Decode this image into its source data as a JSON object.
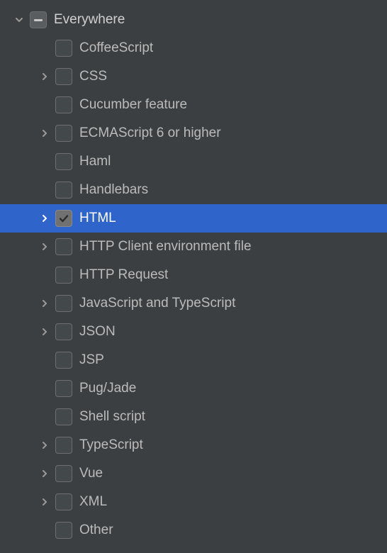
{
  "tree": {
    "root": {
      "label": "Everywhere",
      "expanded": true,
      "checkState": "indeterminate",
      "children": [
        {
          "label": "CoffeeScript",
          "expandable": false,
          "checkState": "unchecked"
        },
        {
          "label": "CSS",
          "expandable": true,
          "checkState": "unchecked"
        },
        {
          "label": "Cucumber feature",
          "expandable": false,
          "checkState": "unchecked"
        },
        {
          "label": "ECMAScript 6 or higher",
          "expandable": true,
          "checkState": "unchecked"
        },
        {
          "label": "Haml",
          "expandable": false,
          "checkState": "unchecked"
        },
        {
          "label": "Handlebars",
          "expandable": false,
          "checkState": "unchecked"
        },
        {
          "label": "HTML",
          "expandable": true,
          "checkState": "checked",
          "selected": true
        },
        {
          "label": "HTTP Client environment file",
          "expandable": true,
          "checkState": "unchecked"
        },
        {
          "label": "HTTP Request",
          "expandable": false,
          "checkState": "unchecked"
        },
        {
          "label": "JavaScript and TypeScript",
          "expandable": true,
          "checkState": "unchecked"
        },
        {
          "label": "JSON",
          "expandable": true,
          "checkState": "unchecked"
        },
        {
          "label": "JSP",
          "expandable": false,
          "checkState": "unchecked"
        },
        {
          "label": "Pug/Jade",
          "expandable": false,
          "checkState": "unchecked"
        },
        {
          "label": "Shell script",
          "expandable": false,
          "checkState": "unchecked"
        },
        {
          "label": "TypeScript",
          "expandable": true,
          "checkState": "unchecked"
        },
        {
          "label": "Vue",
          "expandable": true,
          "checkState": "unchecked"
        },
        {
          "label": "XML",
          "expandable": true,
          "checkState": "unchecked"
        },
        {
          "label": "Other",
          "expandable": false,
          "checkState": "unchecked"
        }
      ]
    }
  }
}
